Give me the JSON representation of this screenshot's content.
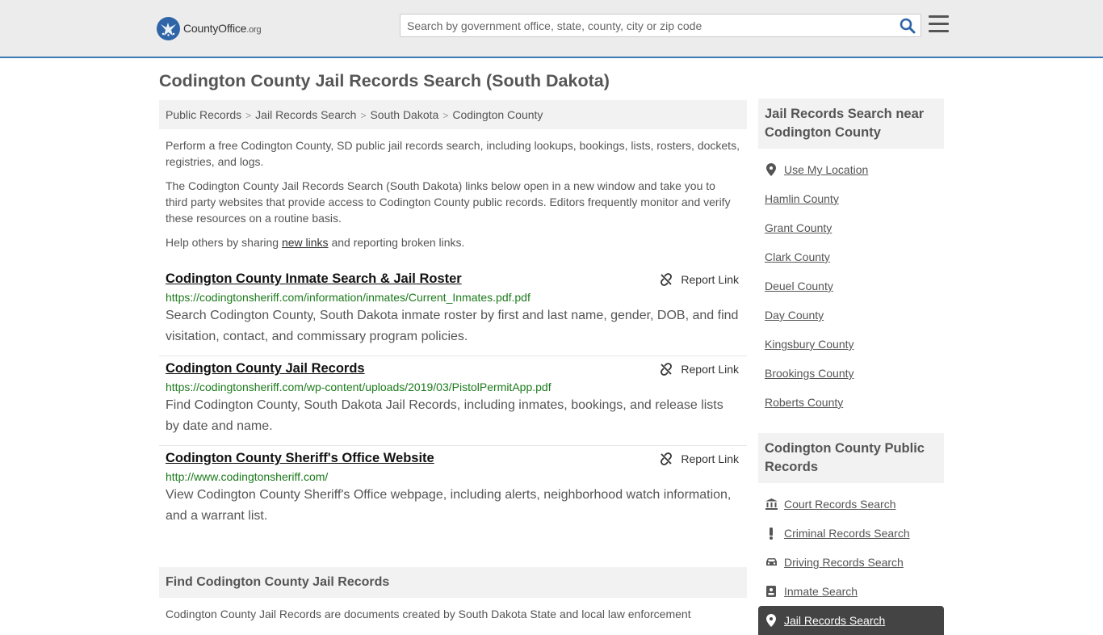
{
  "header": {
    "logo_main": "CountyOffice",
    "logo_suffix": ".org",
    "search_placeholder": "Search by government office, state, county, city or zip code"
  },
  "page_title": "Codington County Jail Records Search (South Dakota)",
  "breadcrumb": [
    "Public Records",
    "Jail Records Search",
    "South Dakota",
    "Codington County"
  ],
  "intro": {
    "p1": "Perform a free Codington County, SD public jail records search, including lookups, bookings, lists, rosters, dockets, registries, and logs.",
    "p2": "The Codington County Jail Records Search (South Dakota) links below open in a new window and take you to third party websites that provide access to Codington County public records. Editors frequently monitor and verify these resources on a routine basis.",
    "p3_before": "Help others by sharing ",
    "p3_link": "new links",
    "p3_after": " and reporting broken links."
  },
  "report_label": "Report Link",
  "results": [
    {
      "title": "Codington County Inmate Search & Jail Roster",
      "url": "https://codingtonsheriff.com/information/inmates/Current_Inmates.pdf.pdf",
      "desc": "Search Codington County, South Dakota inmate roster by first and last name, gender, DOB, and find visitation, contact, and commissary program policies."
    },
    {
      "title": "Codington County Jail Records",
      "url": "https://codingtonsheriff.com/wp-content/uploads/2019/03/PistolPermitApp.pdf",
      "desc": "Find Codington County, South Dakota Jail Records, including inmates, bookings, and release lists by date and name."
    },
    {
      "title": "Codington County Sheriff's Office Website",
      "url": "http://www.codingtonsheriff.com/",
      "desc": "View Codington County Sheriff's Office webpage, including alerts, neighborhood watch information, and a warrant list."
    }
  ],
  "find": {
    "heading": "Find Codington County Jail Records",
    "text": "Codington County Jail Records are documents created by South Dakota State and local law enforcement"
  },
  "sidebar": {
    "nearby_heading": "Jail Records Search near Codington County",
    "use_location": "Use My Location",
    "nearby": [
      "Hamlin County",
      "Grant County",
      "Clark County",
      "Deuel County",
      "Day County",
      "Kingsbury County",
      "Brookings County",
      "Roberts County"
    ],
    "public_heading": "Codington County Public Records",
    "public": [
      {
        "label": "Court Records Search",
        "icon": "courthouse-icon"
      },
      {
        "label": "Criminal Records Search",
        "icon": "exclamation-icon"
      },
      {
        "label": "Driving Records Search",
        "icon": "car-icon"
      },
      {
        "label": "Inmate Search",
        "icon": "id-badge-icon"
      },
      {
        "label": "Jail Records Search",
        "icon": "location-pin-icon"
      }
    ]
  }
}
